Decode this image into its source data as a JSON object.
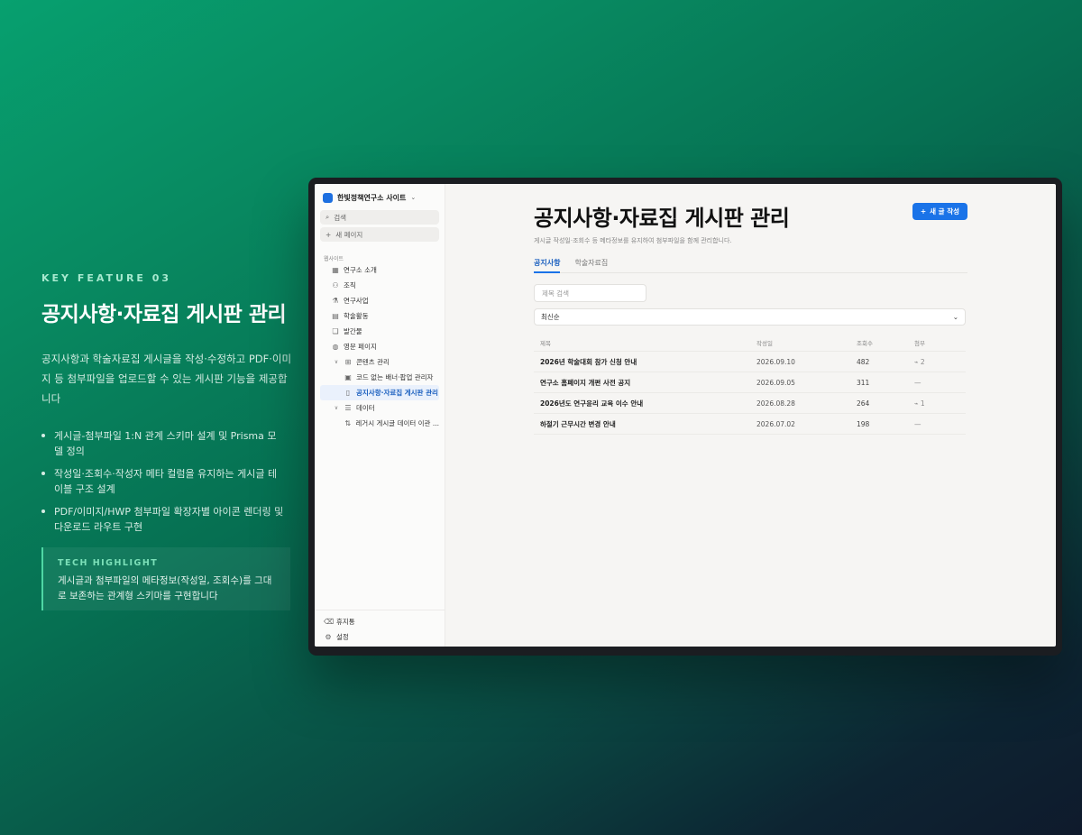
{
  "promo": {
    "kicker": "KEY FEATURE 03",
    "title": "공지사항·자료집 게시판 관리",
    "description": "공지사항과 학술자료집 게시글을 작성·수정하고 PDF·이미지 등 첨부파일을 업로드할 수 있는 게시판 기능을 제공합니다",
    "bullets": [
      "게시글-첨부파일 1:N 관계 스키마 설계 및 Prisma 모델 정의",
      "작성일·조회수·작성자 메타 컬럼을 유지하는 게시글 테이블 구조 설계",
      "PDF/이미지/HWP 첨부파일 확장자별 아이콘 렌더링 및 다운로드 라우트 구현"
    ],
    "tech_highlight": {
      "title": "TECH HIGHLIGHT",
      "text": "게시글과 첨부파일의 메타정보(작성일, 조회수)를 그대로 보존하는 관계형 스키마를 구현합니다"
    }
  },
  "sidebar": {
    "workspace": "한빛정책연구소 사이트",
    "search_label": "검색",
    "new_page_label": "새 페이지",
    "section": "웹사이트",
    "items": [
      {
        "label": "연구소 소개",
        "icon": "building-icon"
      },
      {
        "label": "조직",
        "icon": "users-icon"
      },
      {
        "label": "연구사업",
        "icon": "flask-icon"
      },
      {
        "label": "학술활동",
        "icon": "calendar-icon"
      },
      {
        "label": "발간물",
        "icon": "book-icon"
      },
      {
        "label": "영문 페이지",
        "icon": "globe-icon"
      },
      {
        "label": "콘텐츠 관리",
        "icon": "grid-icon"
      },
      {
        "label": "코드 없는 배너·팝업 관리자",
        "icon": "image-icon"
      },
      {
        "label": "공지사항·자료집 게시판 관리",
        "icon": "clipboard-icon"
      },
      {
        "label": "데이터",
        "icon": "database-icon"
      },
      {
        "label": "레거시 게시글 데이터 이관 ...",
        "icon": "migrate-icon"
      }
    ],
    "bottom": [
      {
        "label": "휴지통",
        "icon": "trash-icon"
      },
      {
        "label": "설정",
        "icon": "settings-icon"
      }
    ]
  },
  "main": {
    "title": "공지사항·자료집 게시판 관리",
    "subtitle": "게시글 작성일·조회수 등 메타정보를 유지하여 첨부파일을 함께 관리합니다.",
    "new_button": "새 글 작성",
    "tabs": [
      "공지사항",
      "학술자료집"
    ],
    "search_placeholder": "제목 검색",
    "sort_value": "최신순",
    "table": {
      "headers": [
        "제목",
        "작성일",
        "조회수",
        "첨부"
      ],
      "rows": [
        {
          "title": "2026년 학술대회 참가 신청 안내",
          "date": "2026.09.10",
          "views": "482",
          "attach": "2"
        },
        {
          "title": "연구소 홈페이지 개편 사전 공지",
          "date": "2026.09.05",
          "views": "311",
          "attach": "—"
        },
        {
          "title": "2026년도 연구윤리 교육 이수 안내",
          "date": "2026.08.28",
          "views": "264",
          "attach": "1"
        },
        {
          "title": "하절기 근무시간 변경 안내",
          "date": "2026.07.02",
          "views": "198",
          "attach": "—"
        }
      ]
    }
  }
}
